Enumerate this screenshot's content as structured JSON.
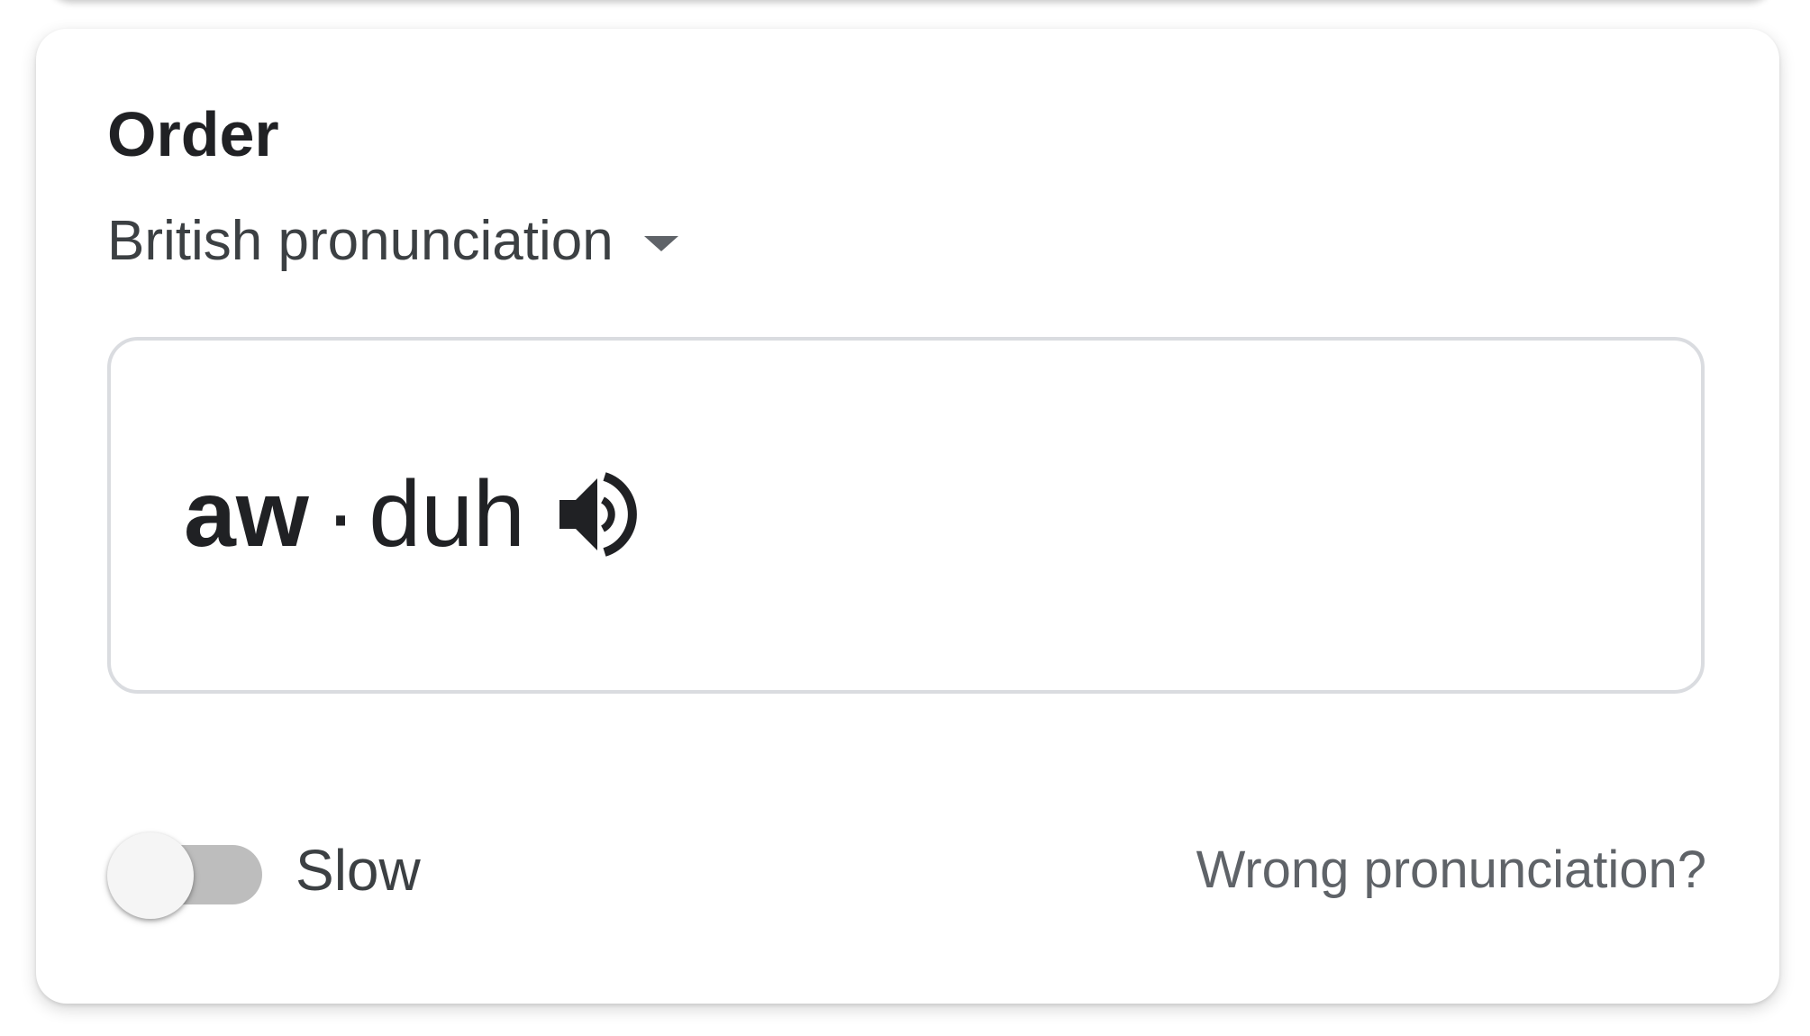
{
  "entry": {
    "word": "Order"
  },
  "accent_selector": {
    "selected": "British pronunciation",
    "icon": "caret-down-icon"
  },
  "pronunciation": {
    "stressed_syllable": "aw",
    "separator": "·",
    "syllable": "duh",
    "speaker_icon": "speaker-volume-icon"
  },
  "controls": {
    "slow_label": "Slow",
    "slow_enabled": false,
    "wrong_pronunciation_link": "Wrong pronunciation?"
  },
  "colors": {
    "primary_text": "#202124",
    "secondary_text": "#5f6368",
    "border": "#dadce0",
    "toggle_track_off": "#bdbdbd"
  }
}
